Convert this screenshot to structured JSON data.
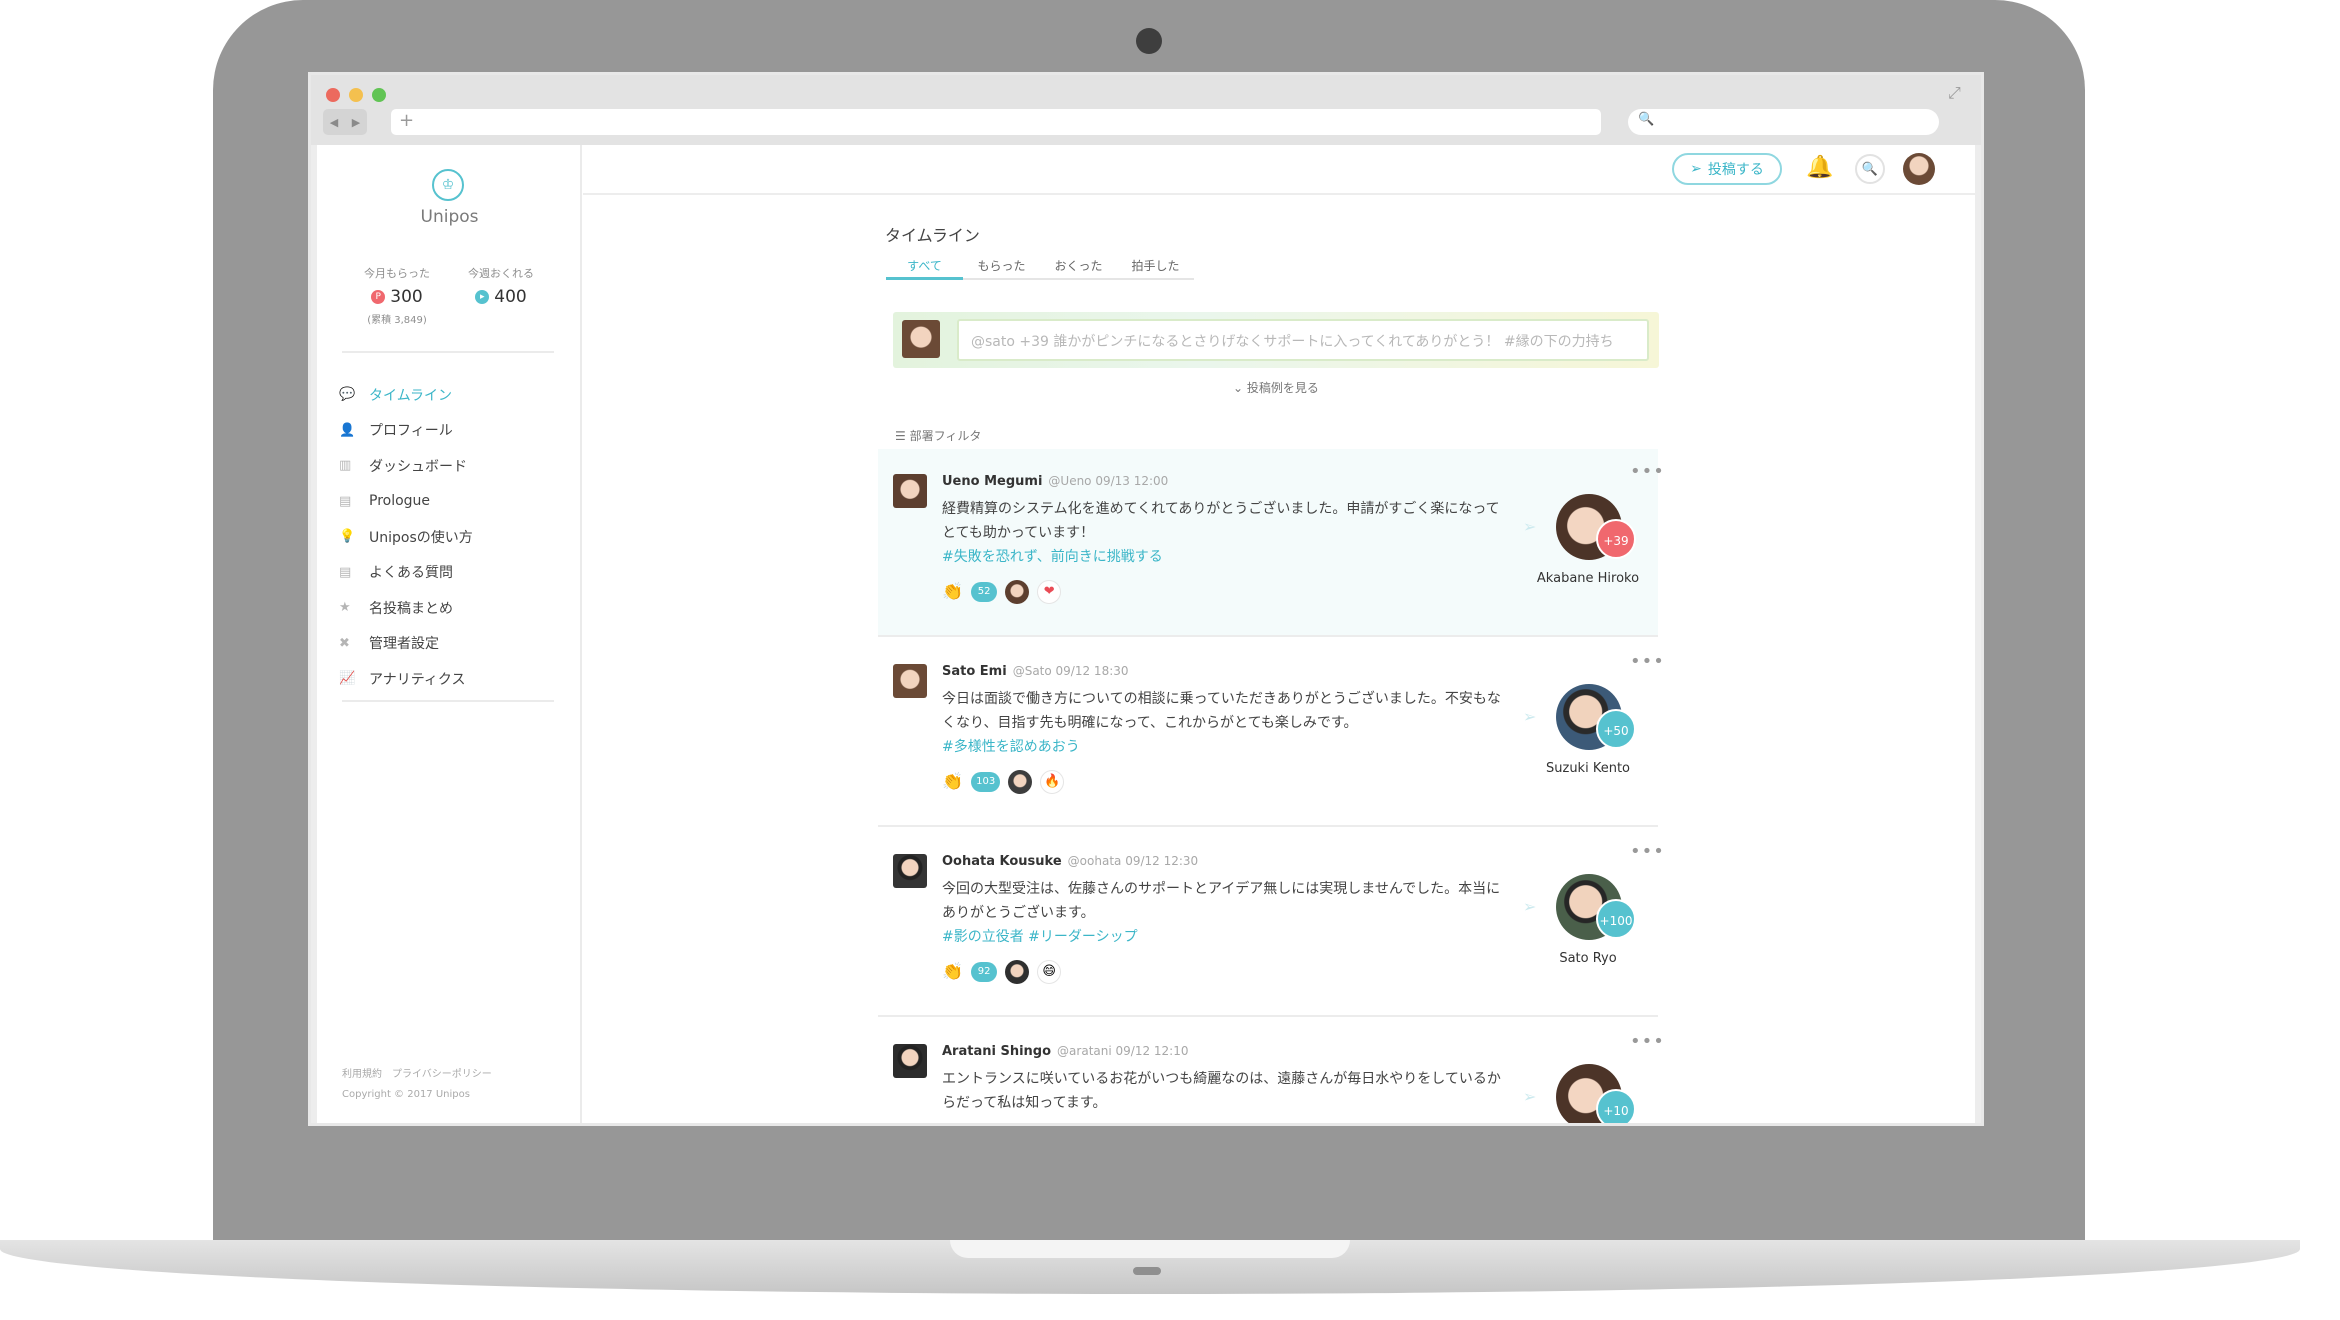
{
  "app": {
    "name": "Unipos",
    "logo_glyph": "♔",
    "stats": {
      "received_label": "今月もらった",
      "received_value": "300",
      "received_total": "(累積 3,849)",
      "received_icon": "P",
      "give_label": "今週おくれる",
      "give_value": "400",
      "give_icon": "▸"
    },
    "menu": [
      {
        "label": "タイムライン",
        "icon": "chat-icon",
        "glyph": "💬"
      },
      {
        "label": "プロフィール",
        "icon": "person-icon",
        "glyph": "👤"
      },
      {
        "label": "ダッシュボード",
        "icon": "bar-chart-icon",
        "glyph": "▥"
      },
      {
        "label": "Prologue",
        "icon": "document-icon",
        "glyph": "▤"
      },
      {
        "label": "Uniposの使い方",
        "icon": "lightbulb-icon",
        "glyph": "💡"
      },
      {
        "label": "よくある質問",
        "icon": "list-icon",
        "glyph": "▤"
      },
      {
        "label": "名投稿まとめ",
        "icon": "star-icon",
        "glyph": "★"
      },
      {
        "label": "管理者設定",
        "icon": "tools-icon",
        "glyph": "✖"
      },
      {
        "label": "アナリティクス",
        "icon": "line-chart-icon",
        "glyph": "📈"
      }
    ],
    "footer": {
      "terms": "利用規約",
      "privacy": "プライバシーポリシー",
      "copyright": "Copyright © 2017 Unipos"
    }
  },
  "topbar": {
    "post_button": "投稿する",
    "post_glyph": "➢",
    "bell_glyph": "🔔",
    "search_glyph": "🔍"
  },
  "browser": {
    "url_plus": "+",
    "back": "◀",
    "forward": "▶",
    "search_glyph": "🔍",
    "expand_glyph": "⤢"
  },
  "timeline": {
    "title": "タイムライン",
    "tabs": [
      "すべて",
      "もらった",
      "おくった",
      "拍手した"
    ],
    "composer_placeholder": "@sato +39 誰かがピンチになるとさりげなくサポートに入ってくれてありがとう！ #縁の下の力持ち",
    "examples_link": "投稿例を見る",
    "filter_label": "部署フィルタ",
    "filter_glyph": "☰",
    "more_glyph": "•••",
    "send_glyph": "➢",
    "clap_glyph": "👏"
  },
  "posts": [
    {
      "author": "Ueno Megumi",
      "meta": "@Ueno  09/13 12:00",
      "body": "経費精算のシステム化を進めてくれてありがとうございました。申請がすごく楽になってとても助かっています！",
      "tags": "#失敗を恐れず、前向きに挑戦する",
      "claps": "52",
      "emoji": "❤",
      "recipient": "Akabane Hiroko",
      "points": "+39",
      "points_color": "#f0686e",
      "highlighted": true
    },
    {
      "author": "Sato Emi",
      "meta": "@Sato  09/12 18:30",
      "body": "今日は面談で働き方についての相談に乗っていただきありがとうございました。不安もなくなり、目指す先も明確になって、これからがとても楽しみです。",
      "tags": "#多様性を認めあおう",
      "claps": "103",
      "emoji": "🔥",
      "recipient": "Suzuki Kento",
      "points": "+50",
      "points_color": "#56c2cf"
    },
    {
      "author": "Oohata Kousuke",
      "meta": "@oohata  09/12 12:30",
      "body": "今回の大型受注は、佐藤さんのサポートとアイデア無しには実現しませんでした。本当にありがとうございます。",
      "tags": "#影の立役者 #リーダーシップ",
      "claps": "92",
      "emoji": "😄",
      "recipient": "Sato Ryo",
      "points": "+100",
      "points_color": "#56c2cf"
    },
    {
      "author": "Aratani Shingo",
      "meta": "@aratani  09/12 12:10",
      "body": "エントランスに咲いているお花がいつも綺麗なのは、遠藤さんが毎日水やりをしているからだって私は知ってます。",
      "tags": "",
      "claps": "",
      "emoji": "",
      "recipient": "",
      "points": "+10",
      "points_color": "#56c2cf"
    }
  ]
}
